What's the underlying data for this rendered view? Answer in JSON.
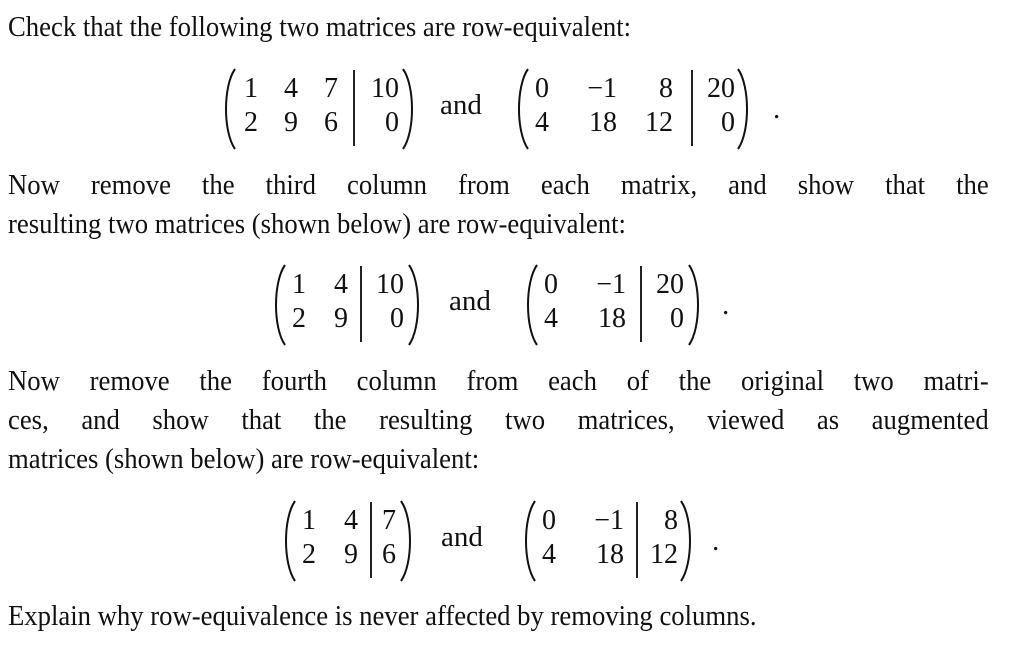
{
  "paragraphs": {
    "p1": [
      "Check that the following two matrices are row-equivalent:"
    ],
    "p2": [
      "Now remove the third column from each matrix, and show that the",
      "resulting two matrices (shown below) are row-equivalent:"
    ],
    "p3": [
      "Now remove the fourth column from each of the original two matri-",
      "ces, and show that the resulting two matrices, viewed as augmented",
      "matrices (shown below) are row-equivalent:"
    ],
    "p4": [
      "Explain why row-equivalence is never affected by removing columns."
    ]
  },
  "connector": "and",
  "terminator": ".",
  "displays": [
    {
      "left": {
        "rows": [
          [
            "1",
            "4",
            "7",
            "10"
          ],
          [
            "2",
            "9",
            "6",
            "0"
          ]
        ],
        "augmented_after_column": 3
      },
      "right": {
        "rows": [
          [
            "0",
            "−1",
            "8",
            "20"
          ],
          [
            "4",
            "18",
            "12",
            "0"
          ]
        ],
        "augmented_after_column": 3
      }
    },
    {
      "left": {
        "rows": [
          [
            "1",
            "4",
            "10"
          ],
          [
            "2",
            "9",
            "0"
          ]
        ],
        "augmented_after_column": 2
      },
      "right": {
        "rows": [
          [
            "0",
            "−1",
            "20"
          ],
          [
            "4",
            "18",
            "0"
          ]
        ],
        "augmented_after_column": 2
      }
    },
    {
      "left": {
        "rows": [
          [
            "1",
            "4",
            "7"
          ],
          [
            "2",
            "9",
            "6"
          ]
        ],
        "augmented_after_column": 2
      },
      "right": {
        "rows": [
          [
            "0",
            "−1",
            "8"
          ],
          [
            "4",
            "18",
            "12"
          ]
        ],
        "augmented_after_column": 2
      }
    }
  ]
}
